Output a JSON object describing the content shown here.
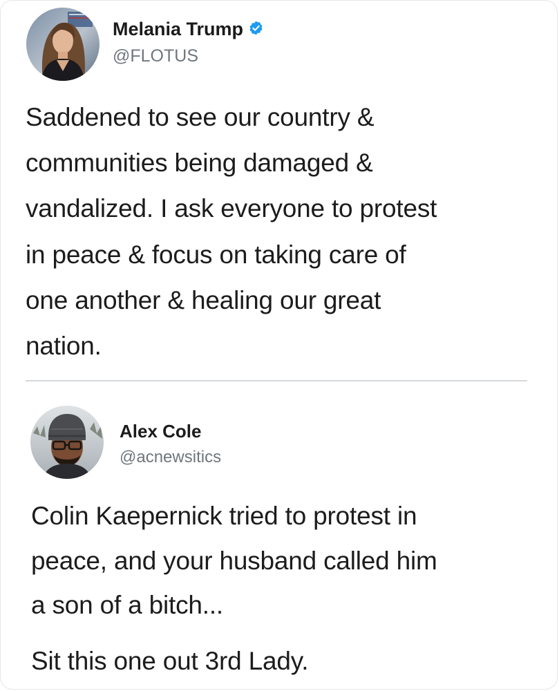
{
  "colors": {
    "verified_badge": "#1d9bf0",
    "handle_text": "#6f777e",
    "divider": "#d5d8da"
  },
  "tweet": {
    "author_name": "Melania Trump",
    "verified_icon": "verified-badge-icon",
    "author_handle": "@FLOTUS",
    "body_lines": [
      "Saddened to see our country &",
      "communities being damaged &",
      "vandalized. I ask everyone to protest",
      "in peace & focus on taking care of",
      "one another & healing our great",
      "nation."
    ]
  },
  "reply": {
    "author_name": "Alex Cole",
    "author_handle": "@acnewsitics",
    "body_lines": [
      "Colin Kaepernick tried to protest in",
      "peace, and your husband called him",
      "a son of a bitch..."
    ],
    "closing_line": "Sit this one out 3rd Lady."
  }
}
